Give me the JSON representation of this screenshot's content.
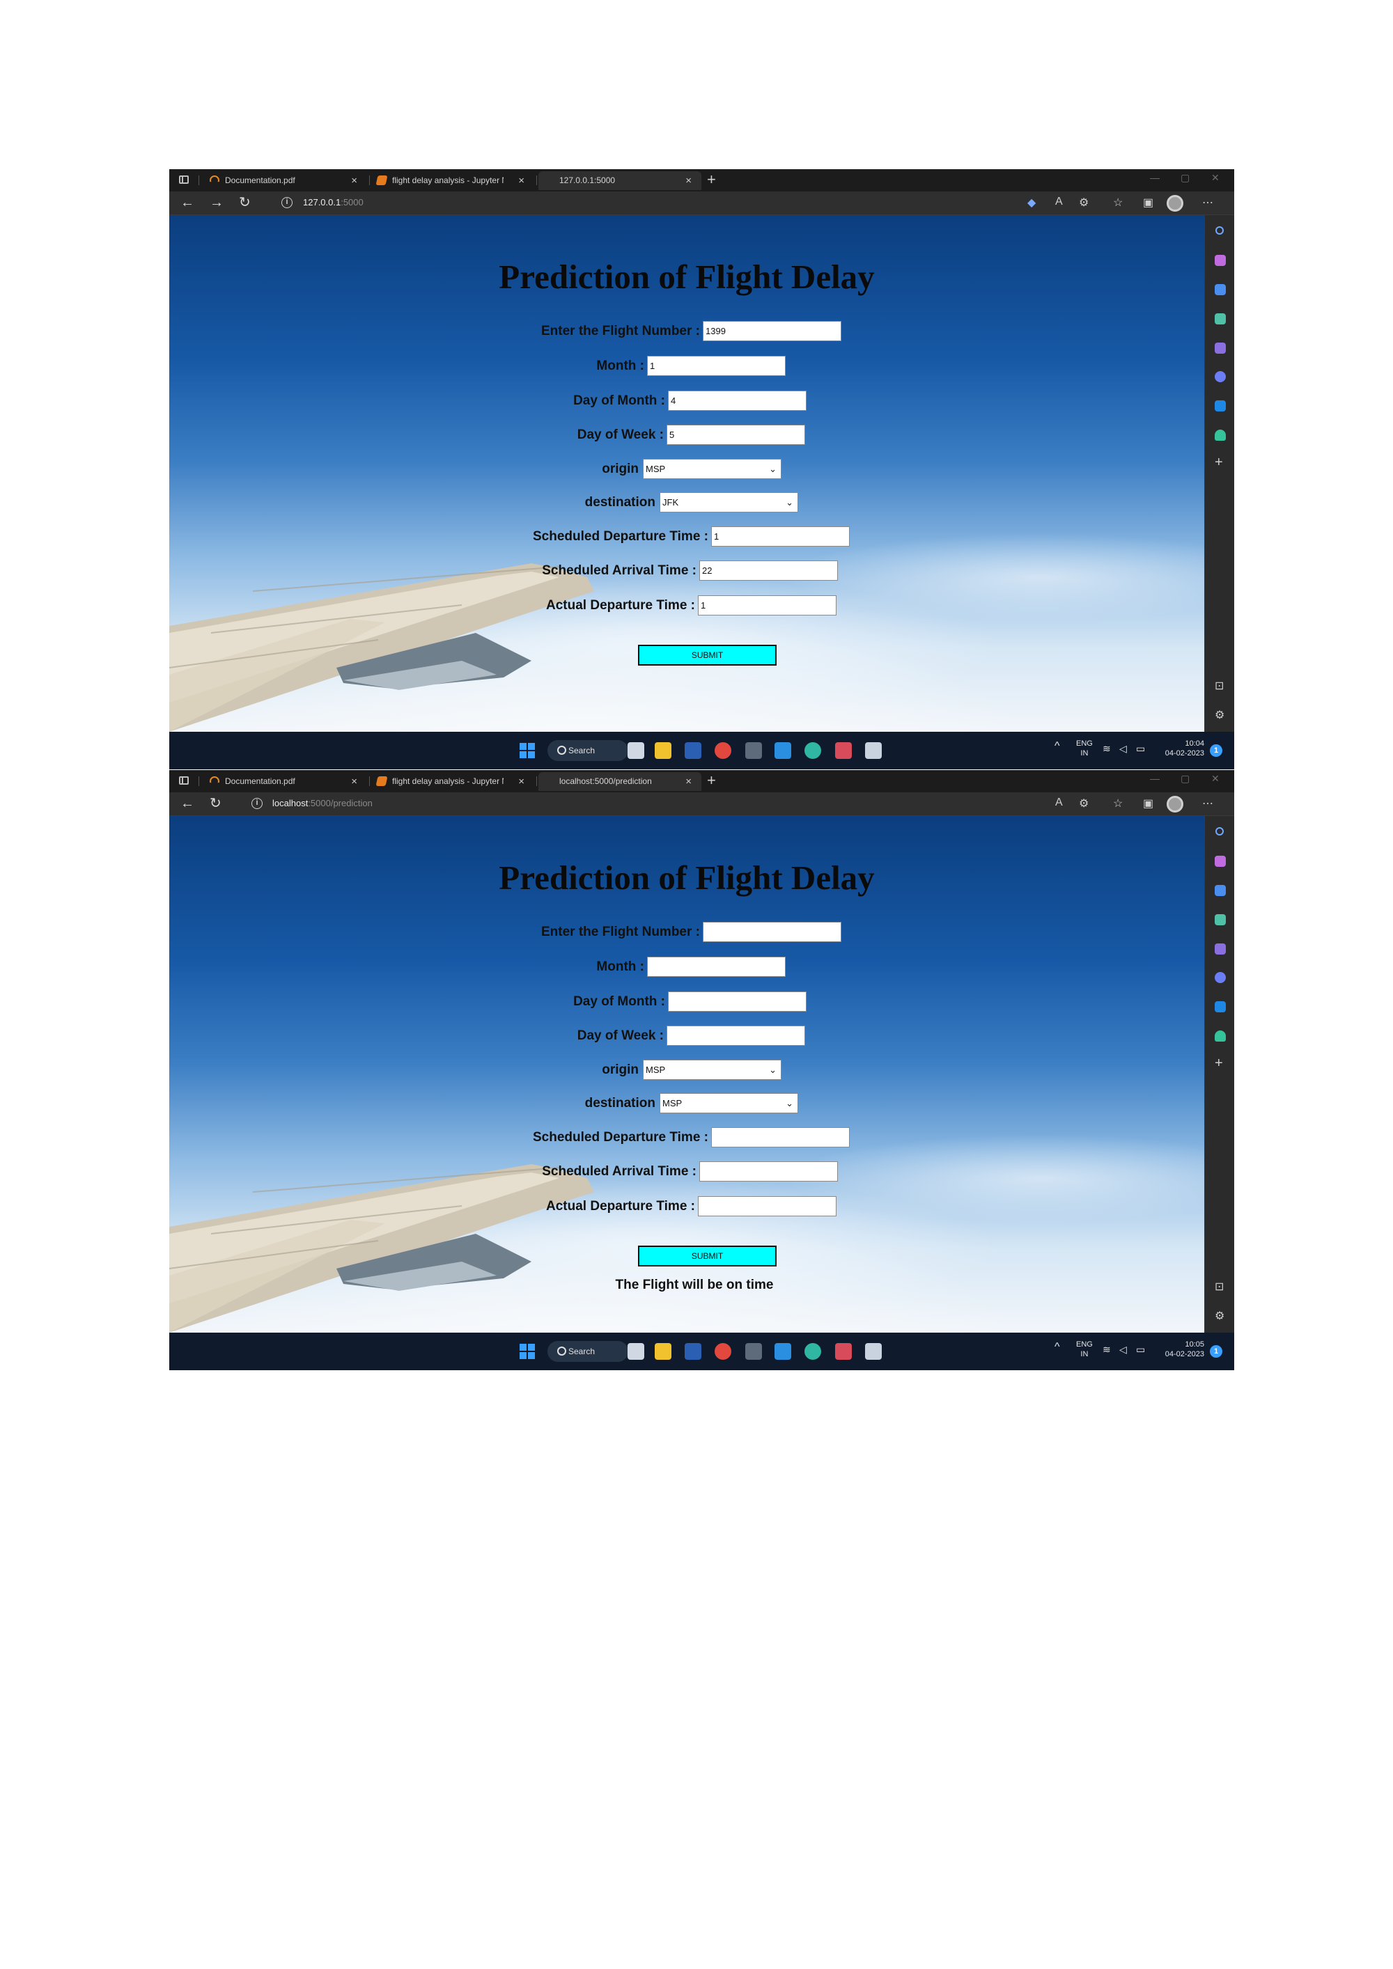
{
  "shots": [
    {
      "tabs": [
        {
          "title": "Documentation.pdf",
          "icon": "pdf",
          "active": false
        },
        {
          "title": "flight delay analysis - Jupyter No",
          "icon": "jupyter",
          "active": false
        },
        {
          "title": "127.0.0.1:5000",
          "icon": "page",
          "active": true
        }
      ],
      "url": {
        "host": "127.0.0.1",
        "rest": ":5000"
      },
      "page": {
        "title": "Prediction of Flight Delay",
        "fields": [
          {
            "label": "Enter the Flight Number :",
            "value": "1399"
          },
          {
            "label": "Month :",
            "value": "1"
          },
          {
            "label": "Day of Month :",
            "value": "4"
          },
          {
            "label": "Day of Week :",
            "value": "5"
          }
        ],
        "origin": {
          "label": "origin",
          "selected": "MSP"
        },
        "destination": {
          "label": "destination",
          "selected": "JFK"
        },
        "fields2": [
          {
            "label": "Scheduled Departure Time :",
            "value": "1"
          },
          {
            "label": "Scheduled Arrival Time :",
            "value": "22"
          },
          {
            "label": "Actual Departure Time :",
            "value": "1"
          }
        ],
        "submit_label": "SUBMIT",
        "result": ""
      },
      "taskbar": {
        "search": "Search",
        "lang": "ENG",
        "region": "IN",
        "time": "10:04",
        "date": "04-02-2023",
        "badge": "1"
      }
    },
    {
      "tabs": [
        {
          "title": "Documentation.pdf",
          "icon": "pdf",
          "active": false
        },
        {
          "title": "flight delay analysis - Jupyter No",
          "icon": "jupyter",
          "active": false
        },
        {
          "title": "localhost:5000/prediction",
          "icon": "page",
          "active": true
        }
      ],
      "url": {
        "host": "localhost",
        "rest": ":5000/prediction"
      },
      "page": {
        "title": "Prediction of Flight Delay",
        "fields": [
          {
            "label": "Enter the Flight Number :",
            "value": ""
          },
          {
            "label": "Month :",
            "value": ""
          },
          {
            "label": "Day of Month :",
            "value": ""
          },
          {
            "label": "Day of Week :",
            "value": ""
          }
        ],
        "origin": {
          "label": "origin",
          "selected": "MSP"
        },
        "destination": {
          "label": "destination",
          "selected": "MSP"
        },
        "fields2": [
          {
            "label": "Scheduled Departure Time :",
            "value": ""
          },
          {
            "label": "Scheduled Arrival Time :",
            "value": ""
          },
          {
            "label": "Actual Departure Time :",
            "value": ""
          }
        ],
        "submit_label": "SUBMIT",
        "result": "The Flight will be on time"
      },
      "taskbar": {
        "search": "Search",
        "lang": "ENG",
        "region": "IN",
        "time": "10:05",
        "date": "04-02-2023",
        "badge": "1"
      }
    }
  ],
  "colors": {
    "submit_bg": "#00ffff",
    "page_sky_top": "#0b3e7f",
    "taskbar": "#0f1b2d",
    "browser_chrome": "#2f2f2f"
  },
  "icons": [
    "tab-actions-icon",
    "pdf-icon",
    "jupyter-icon",
    "page-icon",
    "close-icon",
    "new-tab-icon",
    "back-icon",
    "forward-icon",
    "refresh-icon",
    "site-info-icon",
    "tag-icon",
    "read-aloud-icon",
    "extension-icon",
    "favorites-icon",
    "collections-icon",
    "profile-icon",
    "more-icon",
    "windows-start-icon",
    "search-icon"
  ]
}
